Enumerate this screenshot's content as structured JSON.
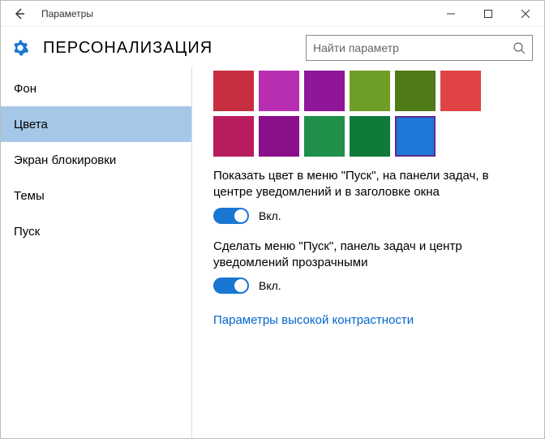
{
  "titlebar": {
    "title": "Параметры"
  },
  "header": {
    "title": "ПЕРСОНАЛИЗАЦИЯ",
    "search_placeholder": "Найти параметр"
  },
  "sidebar": {
    "items": [
      {
        "label": "Фон",
        "selected": false
      },
      {
        "label": "Цвета",
        "selected": true
      },
      {
        "label": "Экран блокировки",
        "selected": false
      },
      {
        "label": "Темы",
        "selected": false
      },
      {
        "label": "Пуск",
        "selected": false
      }
    ]
  },
  "content": {
    "palette": [
      {
        "hex": "#c72f41",
        "selected": false
      },
      {
        "hex": "#b92fb1",
        "selected": false
      },
      {
        "hex": "#8e1697",
        "selected": false
      },
      {
        "hex": "#6f9e26",
        "selected": false
      },
      {
        "hex": "#4f7a16",
        "selected": false
      },
      {
        "hex": "#e04343",
        "selected": false
      },
      {
        "hex": "#b81c5e",
        "selected": false
      },
      {
        "hex": "#8b0f8b",
        "selected": false
      },
      {
        "hex": "#1f8f4a",
        "selected": false
      },
      {
        "hex": "#0f7a3a",
        "selected": false
      },
      {
        "hex": "#1e78d7",
        "selected": true
      }
    ],
    "settings": [
      {
        "label": "Показать цвет в меню \"Пуск\", на панели задач, в центре уведомлений и в заголовке окна",
        "state_label": "Вкл.",
        "state": true
      },
      {
        "label": "Сделать меню \"Пуск\", панель задач и центр уведомлений прозрачными",
        "state_label": "Вкл.",
        "state": true
      }
    ],
    "link": "Параметры высокой контрастности"
  }
}
